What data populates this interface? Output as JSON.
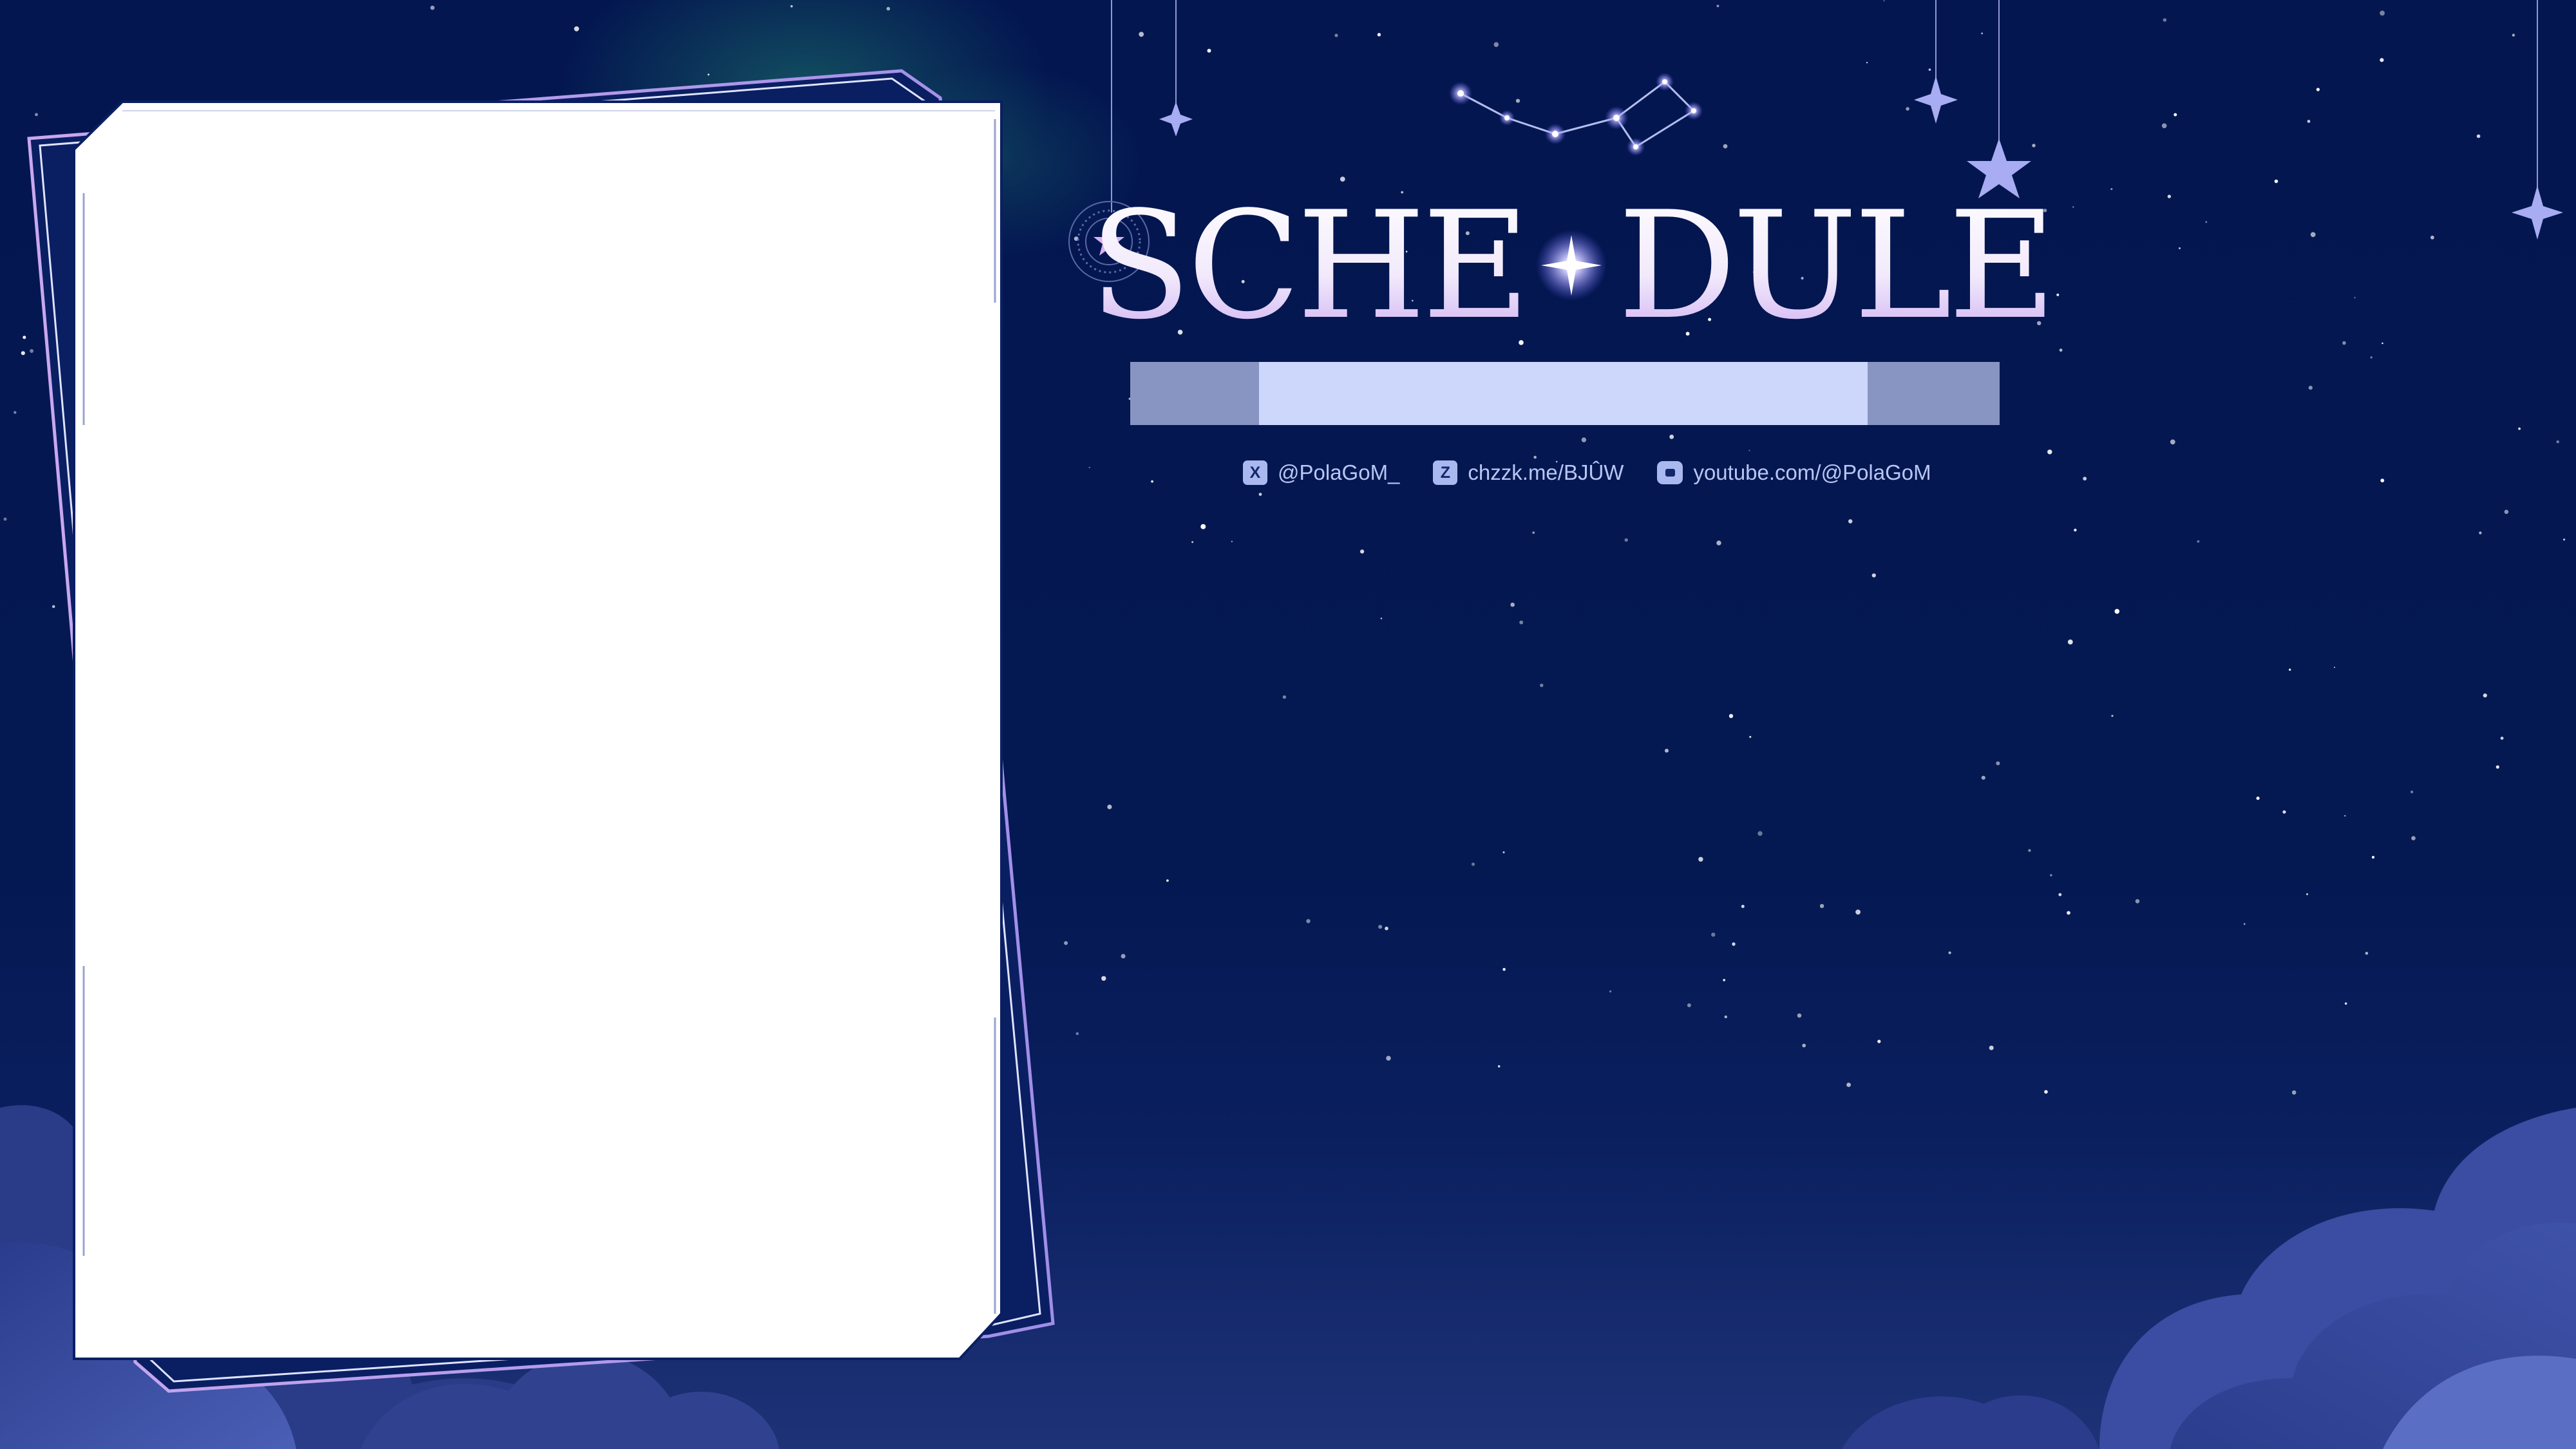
{
  "title": {
    "left": "SCHE",
    "right": "DULE"
  },
  "socials": [
    {
      "icon": "x-logo-icon",
      "text": "@PolaGoM_"
    },
    {
      "icon": "chzzk-logo-icon",
      "text": "chzzk.me/BJÛW"
    },
    {
      "icon": "youtube-logo-icon",
      "text": "youtube.com/@PolaGoM"
    }
  ],
  "colors": {
    "background": "#041651",
    "title_gradient_top": "#ffffff",
    "title_gradient_bottom": "#c9a6f0",
    "banner": "#cdd6fb",
    "star_glow": "#b7b3ff",
    "cloud": "#3c4d9e",
    "panel": "#ffffff"
  }
}
